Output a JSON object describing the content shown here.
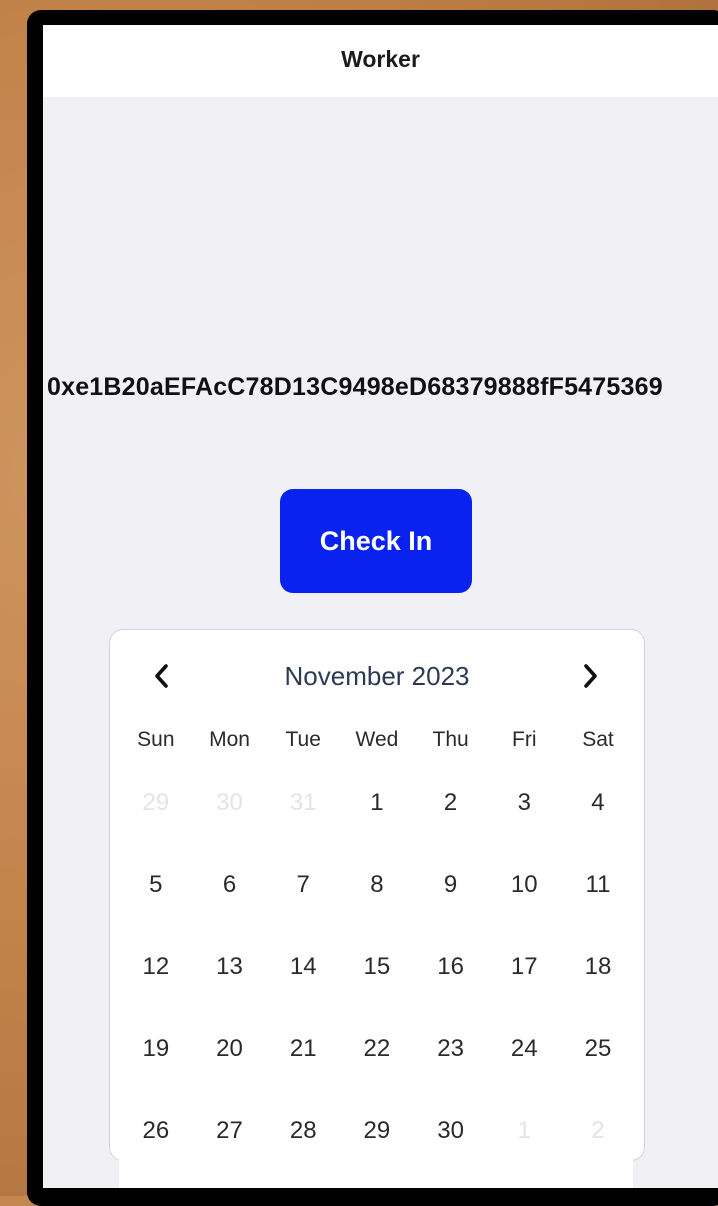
{
  "nav": {
    "title": "Worker"
  },
  "wallet": {
    "address": "0xe1B20aEFAcC78D13C9498eD68379888fF5475369"
  },
  "check_in": {
    "label": "Check In"
  },
  "calendar": {
    "month_label": "November 2023",
    "weekdays": [
      "Sun",
      "Mon",
      "Tue",
      "Wed",
      "Thu",
      "Fri",
      "Sat"
    ],
    "weeks": [
      [
        {
          "d": "29",
          "muted": true
        },
        {
          "d": "30",
          "muted": true
        },
        {
          "d": "31",
          "muted": true
        },
        {
          "d": "1",
          "muted": false
        },
        {
          "d": "2",
          "muted": false
        },
        {
          "d": "3",
          "muted": false
        },
        {
          "d": "4",
          "muted": false
        }
      ],
      [
        {
          "d": "5",
          "muted": false
        },
        {
          "d": "6",
          "muted": false
        },
        {
          "d": "7",
          "muted": false
        },
        {
          "d": "8",
          "muted": false
        },
        {
          "d": "9",
          "muted": false
        },
        {
          "d": "10",
          "muted": false
        },
        {
          "d": "11",
          "muted": false
        }
      ],
      [
        {
          "d": "12",
          "muted": false
        },
        {
          "d": "13",
          "muted": false
        },
        {
          "d": "14",
          "muted": false
        },
        {
          "d": "15",
          "muted": false
        },
        {
          "d": "16",
          "muted": false
        },
        {
          "d": "17",
          "muted": false
        },
        {
          "d": "18",
          "muted": false
        }
      ],
      [
        {
          "d": "19",
          "muted": false
        },
        {
          "d": "20",
          "muted": false
        },
        {
          "d": "21",
          "muted": false
        },
        {
          "d": "22",
          "muted": false
        },
        {
          "d": "23",
          "muted": false
        },
        {
          "d": "24",
          "muted": false
        },
        {
          "d": "25",
          "muted": false
        }
      ],
      [
        {
          "d": "26",
          "muted": false
        },
        {
          "d": "27",
          "muted": false
        },
        {
          "d": "28",
          "muted": false
        },
        {
          "d": "29",
          "muted": false
        },
        {
          "d": "30",
          "muted": false
        },
        {
          "d": "1",
          "muted": true
        },
        {
          "d": "2",
          "muted": true
        }
      ]
    ],
    "icons": {
      "prev": "chevron-left-icon",
      "next": "chevron-right-icon"
    }
  },
  "colors": {
    "accent": "#0a22f0",
    "background": "#f1f0f4",
    "muted_day": "#e3e4ea",
    "month_label": "#2d3a55"
  }
}
